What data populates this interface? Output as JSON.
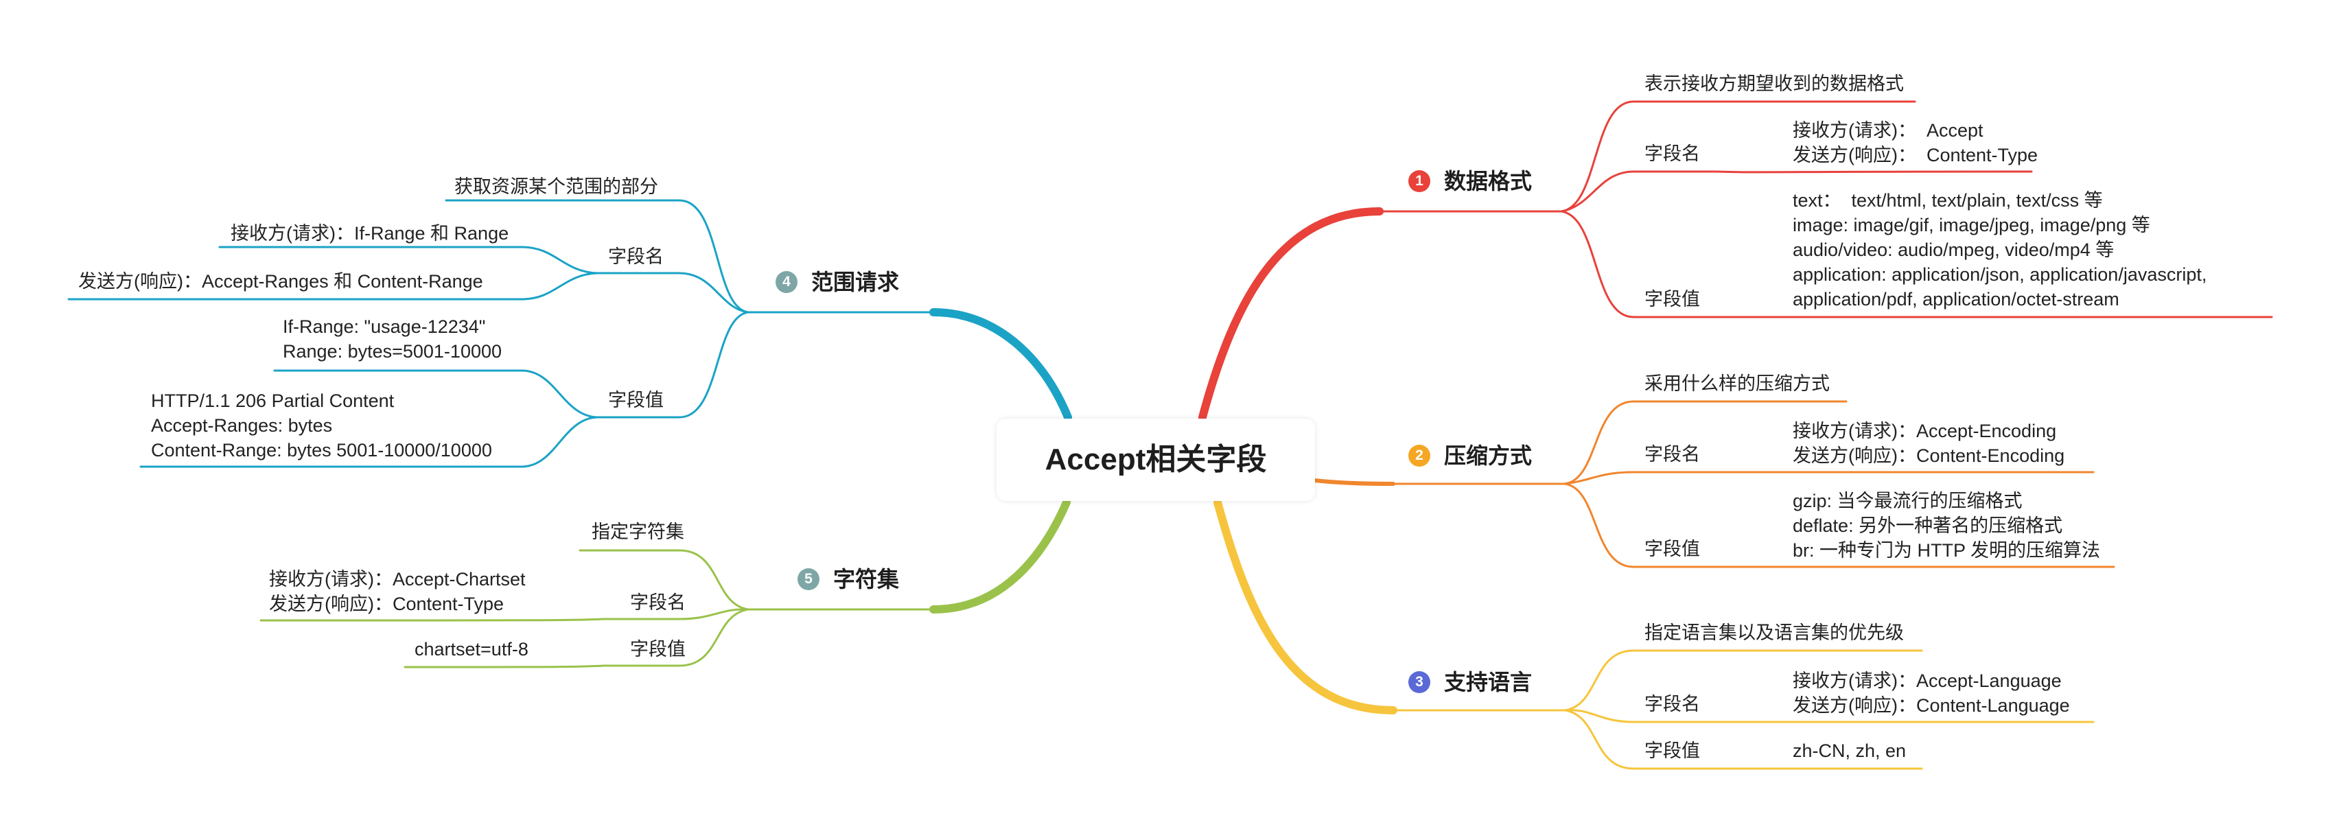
{
  "center": {
    "label": "Accept相关字段"
  },
  "colors": {
    "red": "#e8423b",
    "orange": "#f0862e",
    "yellow": "#f6c53d",
    "blue": "#1ba3c6",
    "green": "#9ac24a",
    "badge_blue": "#5a69d6",
    "badge_gray": "#7ea6a6"
  },
  "branches": [
    {
      "number": "1",
      "title": "数据格式",
      "items": [
        {
          "label": "表示接收方期望收到的数据格式"
        },
        {
          "label": "字段名",
          "detail": "接收方(请求)：  Accept\n发送方(响应)：  Content-Type"
        },
        {
          "label": "字段值",
          "detail": "text：  text/html, text/plain, text/css 等\nimage: image/gif, image/jpeg, image/png 等\naudio/video: audio/mpeg, video/mp4 等\napplication: application/json, application/javascript,\napplication/pdf, application/octet-stream"
        }
      ]
    },
    {
      "number": "2",
      "title": "压缩方式",
      "items": [
        {
          "label": "采用什么样的压缩方式"
        },
        {
          "label": "字段名",
          "detail": "接收方(请求)：Accept-Encoding\n发送方(响应)：Content-Encoding"
        },
        {
          "label": "字段值",
          "detail": "gzip: 当今最流行的压缩格式\ndeflate: 另外一种著名的压缩格式\nbr: 一种专门为 HTTP 发明的压缩算法"
        }
      ]
    },
    {
      "number": "3",
      "title": "支持语言",
      "items": [
        {
          "label": "指定语言集以及语言集的优先级"
        },
        {
          "label": "字段名",
          "detail": "接收方(请求)：Accept-Language\n发送方(响应)：Content-Language"
        },
        {
          "label": "字段值",
          "detail": "zh-CN, zh, en"
        }
      ]
    },
    {
      "number": "4",
      "title": "范围请求",
      "items": [
        {
          "label": "获取资源某个范围的部分"
        },
        {
          "label": "字段名",
          "details": [
            "接收方(请求)：If-Range 和 Range",
            "发送方(响应)：Accept-Ranges 和 Content-Range"
          ]
        },
        {
          "label": "字段值",
          "details": [
            "If-Range: \"usage-12234\"\nRange: bytes=5001-10000",
            "HTTP/1.1 206 Partial Content\nAccept-Ranges: bytes\nContent-Range: bytes 5001-10000/10000"
          ]
        }
      ]
    },
    {
      "number": "5",
      "title": "字符集",
      "items": [
        {
          "label": "指定字符集"
        },
        {
          "label": "字段名",
          "detail": "接收方(请求)：Accept-Chartset\n发送方(响应)：Content-Type"
        },
        {
          "label": "字段值",
          "detail": "chartset=utf-8"
        }
      ]
    }
  ]
}
